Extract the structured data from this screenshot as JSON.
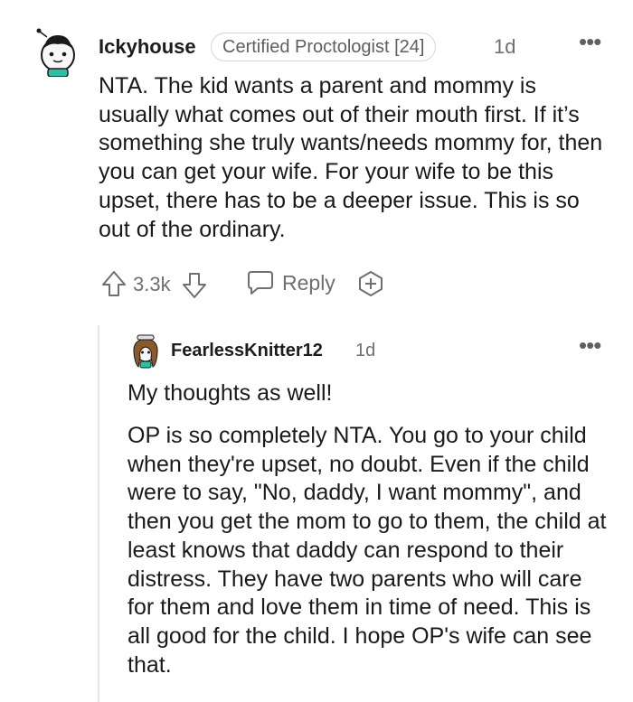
{
  "comment": {
    "username": "Ickyhouse",
    "flair": "Certified Proctologist [24]",
    "time": "1d",
    "more_icon": "more-dots-icon",
    "body": "NTA. The kid wants a parent and mommy is usually what comes out of their mouth first. If it’s something she truly wants/needs mommy for, then you can get your wife. For your wife to be this upset, there has to be a deeper issue. This is so out of the ordinary.",
    "actions": {
      "upvote_icon": "upvote-arrow-icon",
      "score": "3.3k",
      "downvote_icon": "downvote-arrow-icon",
      "reply_icon": "chat-bubble-icon",
      "reply_label": "Reply",
      "award_icon": "plus-award-icon"
    }
  },
  "reply": {
    "username": "FearlessKnitter12",
    "time": "1d",
    "more_icon": "more-dots-icon",
    "paragraphs": [
      "My thoughts as well!",
      "OP is so completely NTA. You go to your child when they're upset, no doubt. Even if the child were to say, \"No, daddy, I want mommy\", and then you get the mom to go to them, the child at least knows that daddy can respond to their distress. They have two parents who will care for them and love them in time of need. This is all good for the child. I hope OP's wife can see that."
    ]
  },
  "colors": {
    "text": "#1a1a1b",
    "meta": "#6f6f6f",
    "avatar_shirt": "#24c4a4",
    "thread_line": "#e6e6e6"
  }
}
